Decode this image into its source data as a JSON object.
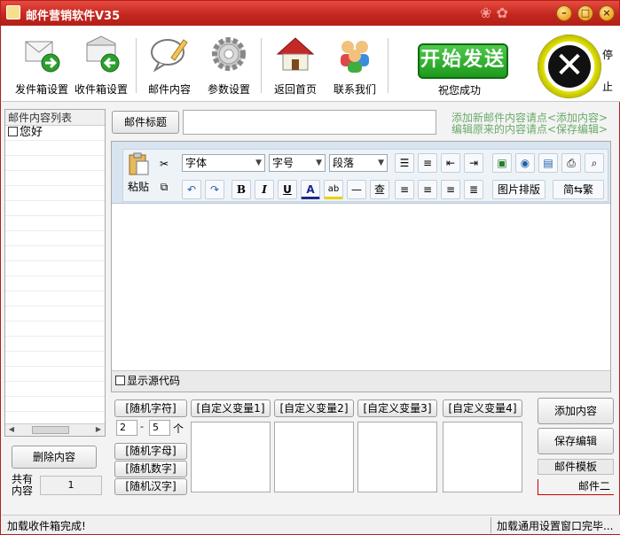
{
  "window": {
    "title": "邮件营销软件V35"
  },
  "toolbar": {
    "items": [
      {
        "label": "发件箱设置",
        "icon": "outbox-settings-icon"
      },
      {
        "label": "收件箱设置",
        "icon": "inbox-settings-icon"
      },
      {
        "label": "邮件内容",
        "icon": "mail-content-icon"
      },
      {
        "label": "参数设置",
        "icon": "gear-icon"
      },
      {
        "label": "返回首页",
        "icon": "home-icon"
      },
      {
        "label": "联系我们",
        "icon": "contact-icon"
      }
    ],
    "start_label": "开始发送",
    "wish_label": "祝您成功",
    "stop_label_top": "停",
    "stop_label_bottom": "止"
  },
  "left": {
    "header": "邮件内容列表",
    "items": [
      {
        "label": "您好"
      }
    ],
    "delete_button": "删除内容",
    "count_label_1": "共有",
    "count_label_2": "内容",
    "count_value": "1"
  },
  "subject": {
    "label": "邮件标题",
    "value": "",
    "hint_line1": "添加新邮件内容请点<添加内容>",
    "hint_line2": "编辑原来的内容请点<保存编辑>"
  },
  "editor": {
    "paste_label": "粘贴",
    "font_select": "字体",
    "size_select": "字号",
    "para_select": "段落",
    "bold": "B",
    "italic": "I",
    "underline": "U",
    "font_color": "A",
    "hr": "—",
    "find": "查",
    "image_layout": "图片排版",
    "convert": "简⇆繁",
    "show_source": "显示源代码"
  },
  "vars": {
    "random_char": "[随机字符]",
    "range_min": "2",
    "range_sep": "-",
    "range_max": "5",
    "range_unit": "个",
    "random_letter": "[随机字母]",
    "random_number": "[随机数字]",
    "random_hanzi": "[随机汉字]",
    "custom": [
      "[自定义变量1]",
      "[自定义变量2]",
      "[自定义变量3]",
      "[自定义变量4]"
    ]
  },
  "actions": {
    "add_content": "添加内容",
    "save_edit": "保存编辑",
    "template": "邮件模板",
    "template_partial": "邮件二"
  },
  "status": {
    "left": "加载收件箱完成!",
    "right": "加载通用设置窗口完毕..."
  },
  "colors": {
    "titlebar": "#c3271f",
    "start_button": "#1d9a1c",
    "hint_text": "#6aaa6a"
  }
}
